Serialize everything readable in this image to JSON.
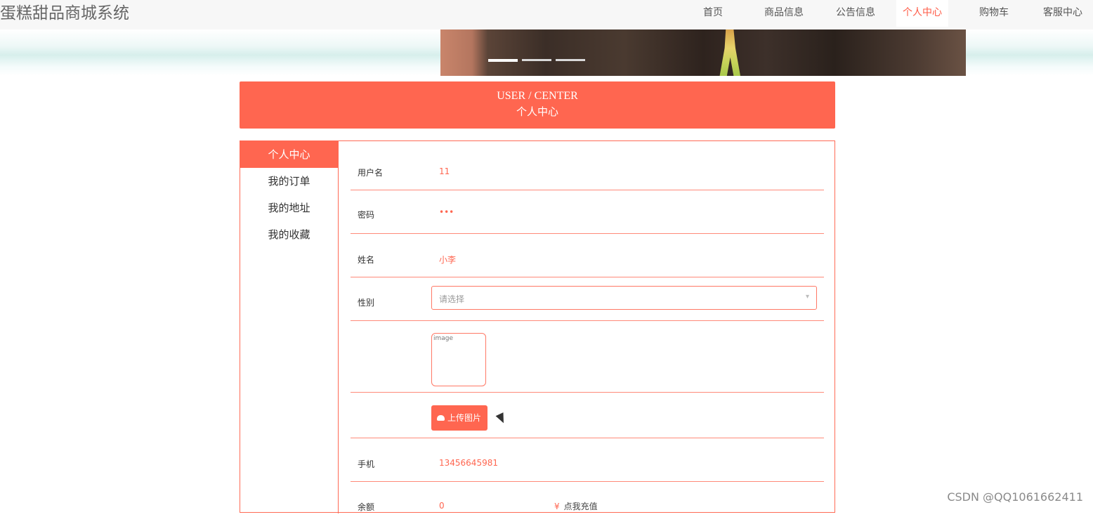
{
  "site": {
    "title": "蛋糕甜品商城系统"
  },
  "nav": [
    {
      "label": "首页",
      "active": false
    },
    {
      "label": "商品信息",
      "active": false
    },
    {
      "label": "公告信息",
      "active": false
    },
    {
      "label": "个人中心",
      "active": true
    },
    {
      "label": "购物车",
      "active": false
    },
    {
      "label": "客服中心",
      "active": false
    }
  ],
  "header": {
    "title_en": "USER / CENTER",
    "title_cn": "个人中心"
  },
  "sidebar": {
    "items": [
      {
        "label": "个人中心",
        "active": true
      },
      {
        "label": "我的订单",
        "active": false
      },
      {
        "label": "我的地址",
        "active": false
      },
      {
        "label": "我的收藏",
        "active": false
      }
    ]
  },
  "form": {
    "username": {
      "label": "用户名",
      "value": "11"
    },
    "password": {
      "label": "密码",
      "value": "•••"
    },
    "name": {
      "label": "姓名",
      "value": "小李"
    },
    "gender": {
      "label": "性别",
      "placeholder": "请选择"
    },
    "image": {
      "alt": "image"
    },
    "upload": {
      "label": "上传图片"
    },
    "phone": {
      "label": "手机",
      "value": "13456645981"
    },
    "balance": {
      "label": "余额",
      "value": "0",
      "recharge_label": "点我充值"
    }
  },
  "watermark": "CSDN @QQ1061662411",
  "colors": {
    "accent": "#ff6650",
    "nav_active": "#ff5b47"
  }
}
